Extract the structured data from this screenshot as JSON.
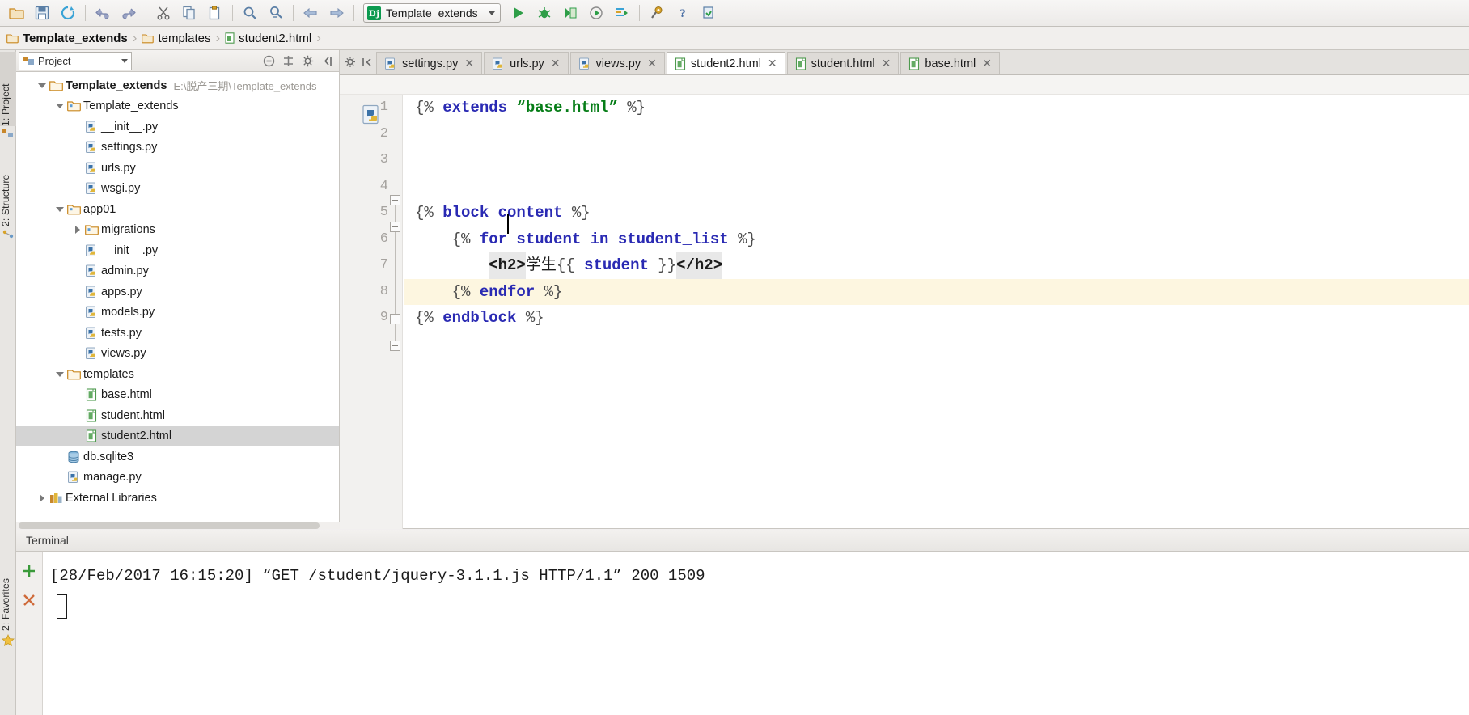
{
  "toolbar": {
    "icons": [
      "open-folder-icon",
      "save-all-icon",
      "sync-icon",
      "undo-icon",
      "redo-icon",
      "cut-icon",
      "copy-icon",
      "paste-icon",
      "find-icon",
      "replace-icon",
      "back-icon",
      "forward-icon"
    ],
    "run_config": {
      "badge": "Dj",
      "label": "Template_extends"
    },
    "run_icons": [
      "run-icon",
      "debug-icon",
      "coverage-icon",
      "profile-icon",
      "run-with-console-icon"
    ],
    "right_icons": [
      "settings-wrench-icon",
      "help-icon",
      "vcs-update-icon"
    ]
  },
  "breadcrumb": {
    "items": [
      {
        "label": "Template_extends",
        "icon": "folder-icon",
        "bold": true
      },
      {
        "label": "templates",
        "icon": "folder-icon",
        "bold": false
      },
      {
        "label": "student2.html",
        "icon": "html-file-icon",
        "bold": false
      }
    ]
  },
  "left_strip": {
    "items": [
      {
        "label": "1: Project",
        "active": true
      },
      {
        "label": "2: Structure",
        "active": false
      }
    ]
  },
  "bottom_strip": {
    "label": "2: Favorites"
  },
  "project_panel": {
    "combo_label": "Project",
    "tools": [
      "collapse-all-icon",
      "target-icon",
      "gear-icon",
      "hide-icon"
    ],
    "tree": [
      {
        "depth": 0,
        "twist": "open",
        "icon": "folder-root-icon",
        "label": "Template_extends",
        "bold": true,
        "path": "E:\\脱产三期\\Template_extends",
        "selected": false
      },
      {
        "depth": 1,
        "twist": "open",
        "icon": "folder-module-icon",
        "label": "Template_extends",
        "bold": false,
        "path": "",
        "selected": false
      },
      {
        "depth": 2,
        "twist": "none",
        "icon": "python-file-icon",
        "label": "__init__.py",
        "bold": false,
        "path": "",
        "selected": false
      },
      {
        "depth": 2,
        "twist": "none",
        "icon": "python-file-icon",
        "label": "settings.py",
        "bold": false,
        "path": "",
        "selected": false
      },
      {
        "depth": 2,
        "twist": "none",
        "icon": "python-file-icon",
        "label": "urls.py",
        "bold": false,
        "path": "",
        "selected": false
      },
      {
        "depth": 2,
        "twist": "none",
        "icon": "python-file-icon",
        "label": "wsgi.py",
        "bold": false,
        "path": "",
        "selected": false
      },
      {
        "depth": 1,
        "twist": "open",
        "icon": "folder-module-icon",
        "label": "app01",
        "bold": false,
        "path": "",
        "selected": false
      },
      {
        "depth": 2,
        "twist": "closed",
        "icon": "folder-module-icon",
        "label": "migrations",
        "bold": false,
        "path": "",
        "selected": false
      },
      {
        "depth": 2,
        "twist": "none",
        "icon": "python-file-icon",
        "label": "__init__.py",
        "bold": false,
        "path": "",
        "selected": false
      },
      {
        "depth": 2,
        "twist": "none",
        "icon": "python-file-icon",
        "label": "admin.py",
        "bold": false,
        "path": "",
        "selected": false
      },
      {
        "depth": 2,
        "twist": "none",
        "icon": "python-file-icon",
        "label": "apps.py",
        "bold": false,
        "path": "",
        "selected": false
      },
      {
        "depth": 2,
        "twist": "none",
        "icon": "python-file-icon",
        "label": "models.py",
        "bold": false,
        "path": "",
        "selected": false
      },
      {
        "depth": 2,
        "twist": "none",
        "icon": "python-file-icon",
        "label": "tests.py",
        "bold": false,
        "path": "",
        "selected": false
      },
      {
        "depth": 2,
        "twist": "none",
        "icon": "python-file-icon",
        "label": "views.py",
        "bold": false,
        "path": "",
        "selected": false
      },
      {
        "depth": 1,
        "twist": "open",
        "icon": "folder-icon",
        "label": "templates",
        "bold": false,
        "path": "",
        "selected": false
      },
      {
        "depth": 2,
        "twist": "none",
        "icon": "html-file-icon",
        "label": "base.html",
        "bold": false,
        "path": "",
        "selected": false
      },
      {
        "depth": 2,
        "twist": "none",
        "icon": "html-file-icon",
        "label": "student.html",
        "bold": false,
        "path": "",
        "selected": false
      },
      {
        "depth": 2,
        "twist": "none",
        "icon": "html-file-icon",
        "label": "student2.html",
        "bold": false,
        "path": "",
        "selected": true
      },
      {
        "depth": 1,
        "twist": "none",
        "icon": "database-icon",
        "label": "db.sqlite3",
        "bold": false,
        "path": "",
        "selected": false
      },
      {
        "depth": 1,
        "twist": "none",
        "icon": "python-file-icon",
        "label": "manage.py",
        "bold": false,
        "path": "",
        "selected": false
      },
      {
        "depth": 0,
        "twist": "closed",
        "icon": "library-icon",
        "label": "External Libraries",
        "bold": false,
        "path": "",
        "selected": false
      }
    ]
  },
  "editor_tabs": [
    {
      "label": "settings.py",
      "icon": "python-file-icon",
      "active": false
    },
    {
      "label": "urls.py",
      "icon": "python-file-icon",
      "active": false
    },
    {
      "label": "views.py",
      "icon": "python-file-icon",
      "active": false
    },
    {
      "label": "student2.html",
      "icon": "html-file-icon",
      "active": true
    },
    {
      "label": "student.html",
      "icon": "html-file-icon",
      "active": false
    },
    {
      "label": "base.html",
      "icon": "html-file-icon",
      "active": false
    }
  ],
  "editor": {
    "lines": [
      {
        "num": "1",
        "highlight": false,
        "fold": "none",
        "tokens": [
          {
            "t": "{% ",
            "c": "br"
          },
          {
            "t": "extends",
            "c": "kw"
          },
          {
            "t": " ",
            "c": "plain"
          },
          {
            "t": "“base.html”",
            "c": "str"
          },
          {
            "t": " %}",
            "c": "br"
          }
        ]
      },
      {
        "num": "2",
        "highlight": false,
        "fold": "none",
        "tokens": []
      },
      {
        "num": "3",
        "highlight": false,
        "fold": "none",
        "tokens": []
      },
      {
        "num": "4",
        "highlight": false,
        "fold": "none",
        "tokens": []
      },
      {
        "num": "5",
        "highlight": false,
        "fold": "start",
        "tokens": [
          {
            "t": "{% ",
            "c": "br"
          },
          {
            "t": "block content",
            "c": "kw"
          },
          {
            "t": " %}",
            "c": "br"
          }
        ]
      },
      {
        "num": "6",
        "highlight": false,
        "fold": "start",
        "tokens": [
          {
            "t": "    {% ",
            "c": "br"
          },
          {
            "t": "for student in student_list",
            "c": "kw"
          },
          {
            "t": " %}",
            "c": "br"
          }
        ]
      },
      {
        "num": "7",
        "highlight": false,
        "fold": "none",
        "tokens": [
          {
            "t": "        ",
            "c": "plain"
          },
          {
            "t": "<h2>",
            "c": "tagk"
          },
          {
            "t": "学生",
            "c": "han"
          },
          {
            "t": "{{ ",
            "c": "br"
          },
          {
            "t": "student",
            "c": "varx"
          },
          {
            "t": " }}",
            "c": "br"
          },
          {
            "t": "</h2>",
            "c": "tagk"
          }
        ]
      },
      {
        "num": "8",
        "highlight": true,
        "fold": "end",
        "tokens": [
          {
            "t": "    {% ",
            "c": "br"
          },
          {
            "t": "endfor",
            "c": "kw"
          },
          {
            "t": " %}",
            "c": "br"
          }
        ]
      },
      {
        "num": "9",
        "highlight": false,
        "fold": "end",
        "tokens": [
          {
            "t": "{% ",
            "c": "br"
          },
          {
            "t": "endblock",
            "c": "kw"
          },
          {
            "t": " %}",
            "c": "br"
          }
        ]
      }
    ],
    "gutter_icon": "python-django-file-icon"
  },
  "terminal": {
    "title": "Terminal",
    "buttons": [
      "add-tab-icon",
      "close-tab-icon"
    ],
    "output": "[28/Feb/2017 16:15:20] “GET /student/jquery-3.1.1.js HTTP/1.1” 200 1509"
  },
  "colors": {
    "accent_green": "#0c9a4f",
    "keyword_blue": "#2a2ab3",
    "string_green": "#067d17",
    "highlight_line": "#fdf6e0",
    "selection_gray": "#d4d4d4"
  }
}
